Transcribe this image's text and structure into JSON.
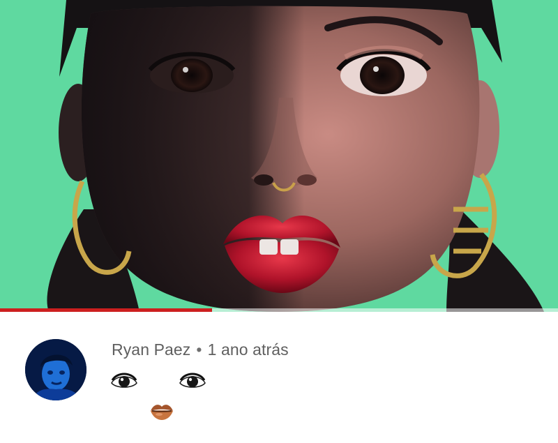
{
  "video": {
    "background_color": "#5fd9a0",
    "progress": 0.38,
    "progress_color": "#cc1f1f"
  },
  "comment": {
    "author": "Ryan Paez",
    "separator": "•",
    "timestamp": "1 ano atrás",
    "body": [
      "eye-emoji",
      "eye-emoji",
      "lips-emoji"
    ]
  }
}
